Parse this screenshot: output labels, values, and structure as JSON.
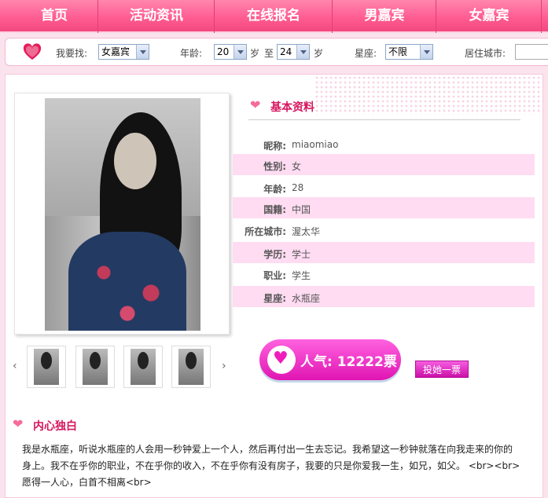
{
  "nav": {
    "items": [
      "首页",
      "活动资讯",
      "在线报名",
      "男嘉宾",
      "女嘉宾"
    ]
  },
  "search": {
    "looking_label": "我要找:",
    "looking_value": "女嘉宾",
    "age_label": "年龄:",
    "age_from": "20",
    "age_unit1": "岁",
    "age_to_label": "至",
    "age_to": "24",
    "age_unit2": "岁",
    "star_label": "星座:",
    "star_value": "不限",
    "city_label": "居住城市:"
  },
  "profile": {
    "section_title": "基本资料",
    "fields": [
      {
        "k": "昵称:",
        "v": "miaomiao"
      },
      {
        "k": "性别:",
        "v": "女"
      },
      {
        "k": "年龄:",
        "v": "28"
      },
      {
        "k": "国籍:",
        "v": "中国"
      },
      {
        "k": "所在城市:",
        "v": "渥太华"
      },
      {
        "k": "学历:",
        "v": "学士"
      },
      {
        "k": "职业:",
        "v": "学生"
      },
      {
        "k": "星座:",
        "v": "水瓶座"
      }
    ],
    "popularity": "人气:  12222票",
    "vote_button": "投她一票"
  },
  "bio": {
    "title": "内心独白",
    "line1": "我是水瓶座，听说水瓶座的人会用一秒钟爱上一个人，然后再付出一生去忘记。我希望这一秒钟就落在向我走来的你的",
    "line2": "身上。我不在乎你的职业，不在乎你的收入，不在乎你有没有房子，我要的只是你爱我一生，如兄，如父。 <br><br>",
    "line3": "愿得一人心，白首不相离<br>"
  },
  "colors": {
    "nav_pink": "#ff5d93",
    "title_red": "#d6165f",
    "row_pink": "#ffdcf2",
    "vote_magenta": "#e015b2"
  }
}
